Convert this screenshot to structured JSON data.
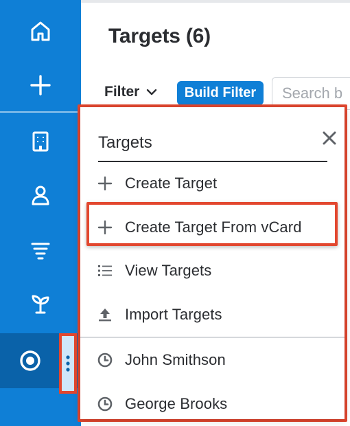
{
  "sidebar": {
    "items": [
      {
        "name": "home",
        "icon": "home-icon"
      },
      {
        "name": "quick-create",
        "icon": "plus-icon"
      },
      {
        "name": "accounts",
        "icon": "building-icon"
      },
      {
        "name": "contacts",
        "icon": "person-icon"
      },
      {
        "name": "filters",
        "icon": "filter-icon"
      },
      {
        "name": "opportunities",
        "icon": "sprout-icon"
      },
      {
        "name": "targets",
        "icon": "target-icon",
        "active": true
      }
    ],
    "more_icon": "vertical-ellipsis-icon"
  },
  "main": {
    "title": "Targets (6)",
    "filter_label": "Filter",
    "build_filter_label": "Build Filter",
    "search_placeholder": "Search b"
  },
  "menu": {
    "title": "Targets",
    "close_icon": "close-icon",
    "items": [
      {
        "label": "Create Target",
        "icon": "plus-icon"
      },
      {
        "label": "Create Target From vCard",
        "icon": "plus-icon",
        "highlighted": true
      },
      {
        "label": "View Targets",
        "icon": "list-icon"
      },
      {
        "label": "Import Targets",
        "icon": "upload-icon"
      }
    ],
    "recent": [
      {
        "label": "John Smithson",
        "icon": "clock-icon"
      },
      {
        "label": "George Brooks",
        "icon": "clock-icon"
      }
    ]
  },
  "colors": {
    "sidebar": "#0f7fd6",
    "sidebar_active": "#0a62a9",
    "accent": "#0f7fd6",
    "highlight_outline": "#e2472f"
  }
}
